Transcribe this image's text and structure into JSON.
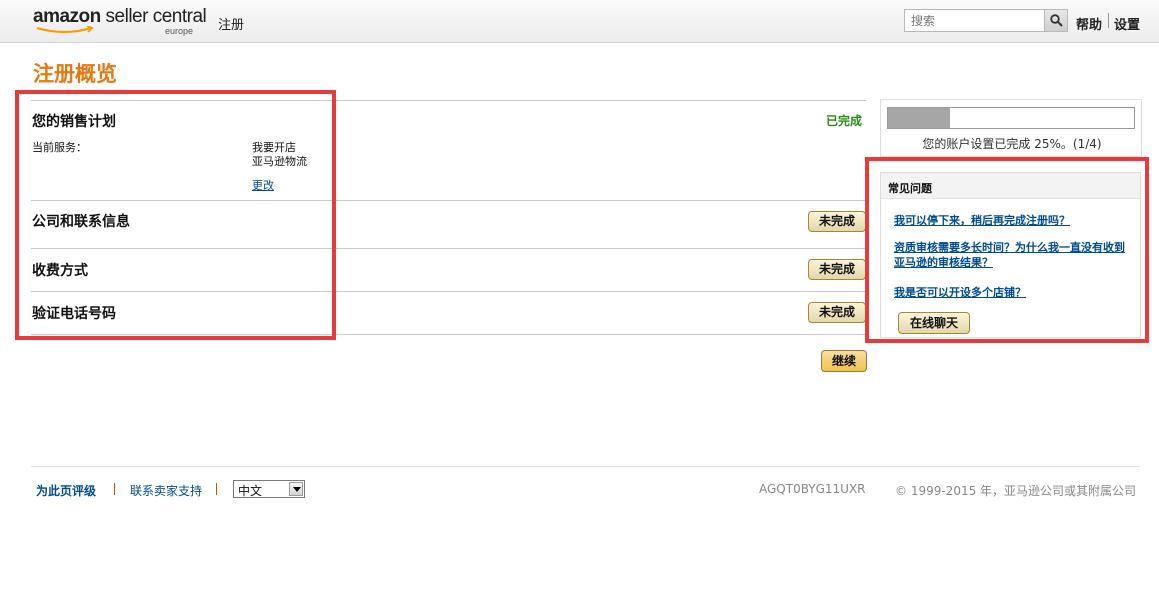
{
  "header": {
    "logo_brand_bold": "amazon",
    "logo_brand_rest": " seller central",
    "logo_sub": "europe",
    "nav_register": "注册",
    "search_placeholder": "搜索",
    "help": "帮助",
    "settings": "设置"
  },
  "page": {
    "title": "注册概览"
  },
  "plan": {
    "title": "您的销售计划",
    "status": "已完成",
    "service_label": "当前服务：",
    "service_values": [
      "我要开店",
      "亚马逊物流"
    ],
    "change_link": "更改"
  },
  "sections": [
    {
      "title": "公司和联系信息",
      "button": "未完成"
    },
    {
      "title": "收费方式",
      "button": "未完成"
    },
    {
      "title": "验证电话号码",
      "button": "未完成"
    }
  ],
  "continue_button": "继续",
  "progress": {
    "fraction": 0.25,
    "text": "您的账户设置已完成 25%。(1/4)"
  },
  "faq": {
    "title": "常见问题",
    "links": [
      "我可以停下来，稍后再完成注册吗？",
      "资质审核需要多长时间？为什么我一直没有收到亚马逊的审核结果？",
      "我是否可以开设多个店铺？"
    ],
    "chat_button": "在线聊天"
  },
  "footer": {
    "rate_page": "为此页评级",
    "contact_support": "联系卖家支持",
    "language": "中文",
    "code": "AGQT0BYG11UXR",
    "copyright": "© 1999-2015 年，亚马逊公司或其附属公司"
  },
  "colors": {
    "title_orange": "#e47911",
    "done_green": "#2a8a15",
    "link_blue": "#004b91",
    "highlight_red": "#e8393b"
  }
}
